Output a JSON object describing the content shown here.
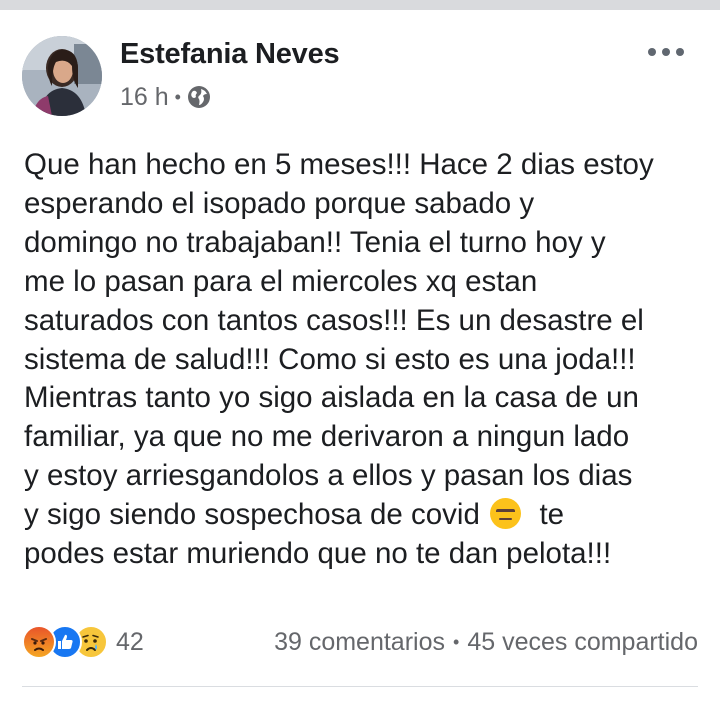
{
  "post": {
    "author": "Estefania Neves",
    "time": "16 h",
    "meta_separator": "•",
    "privacy_icon": "globe-icon",
    "lines": [
      "Que han hecho en 5 meses!!! Hace 2 dias estoy",
      "esperando el isopado porque sabado y",
      "domingo no trabajaban!! Tenia el turno hoy y",
      "me lo pasan para el miercoles xq estan",
      "saturados con tantos casos!!! Es un desastre el",
      "sistema de salud!!! Como si esto es una joda!!!",
      "Mientras tanto yo sigo aislada en la casa de un",
      "familiar, ya que no me derivaron a ningun lado",
      "y estoy arriesgandolos a ellos y pasan los dias"
    ],
    "line_with_emoji_before": "y sigo siendo sospechosa de covid ",
    "emoji": "expressionless-face-emoji",
    "line_with_emoji_after": "  te",
    "last_line": "podes estar muriendo que no te dan pelota!!!"
  },
  "reactions": {
    "icons": [
      "angry-reaction-icon",
      "like-reaction-icon",
      "sad-reaction-icon"
    ],
    "count": "42"
  },
  "stats": {
    "comments": "39 comentarios",
    "separator": "•",
    "shares": "45 veces compartido"
  }
}
